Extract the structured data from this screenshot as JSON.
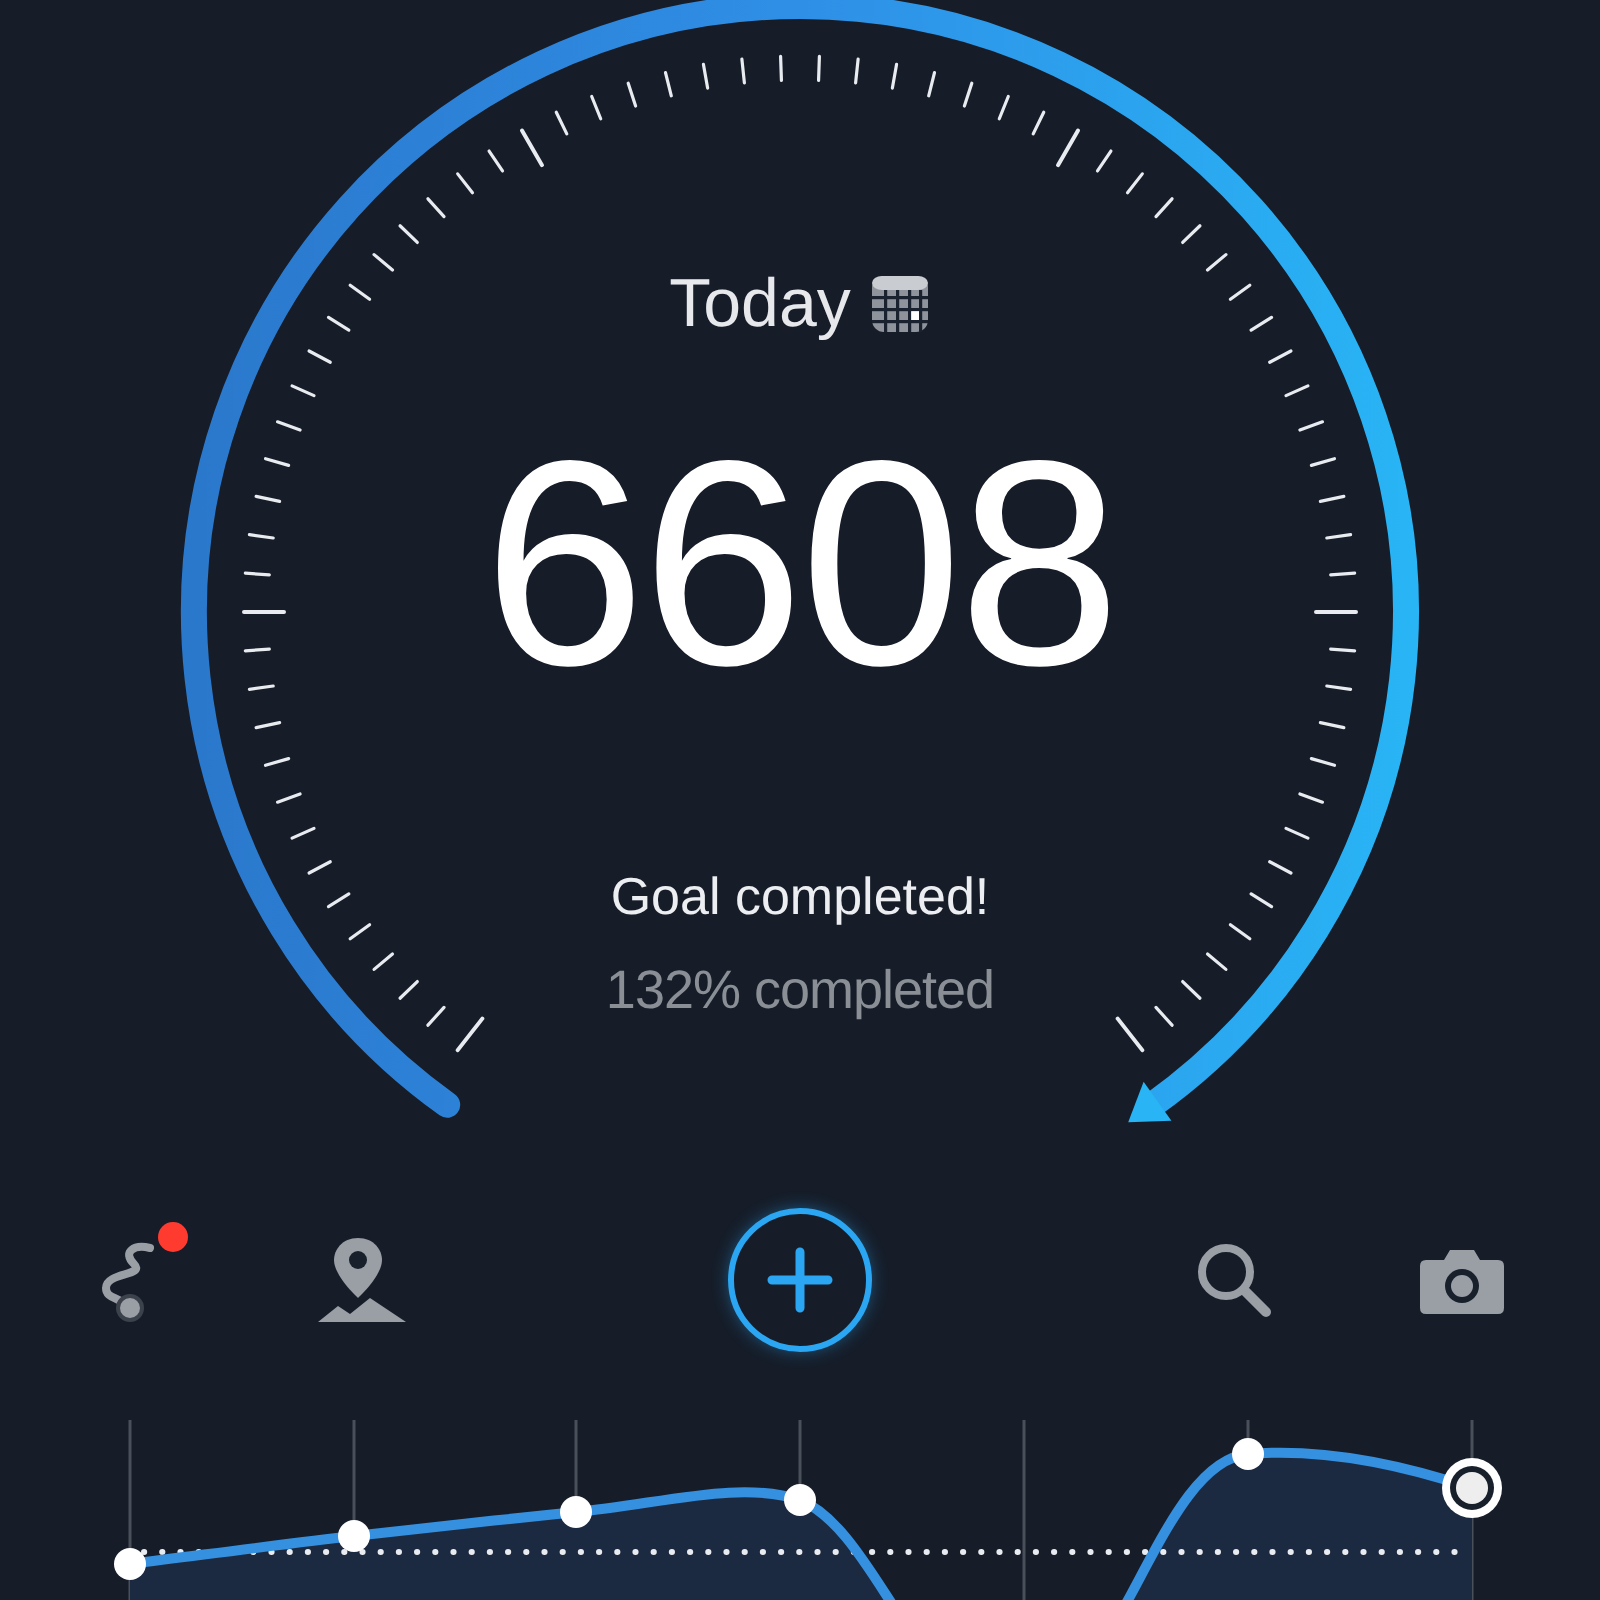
{
  "gauge": {
    "title": "Today",
    "steps": "6608",
    "status": "Goal completed!",
    "percent": "132% completed"
  },
  "toolbar": [
    {
      "kind": "route",
      "badge": true
    },
    {
      "kind": "map",
      "badge": false
    },
    {
      "kind": "add",
      "badge": false
    },
    {
      "kind": "search",
      "badge": false
    },
    {
      "kind": "camera",
      "badge": false
    }
  ]
}
